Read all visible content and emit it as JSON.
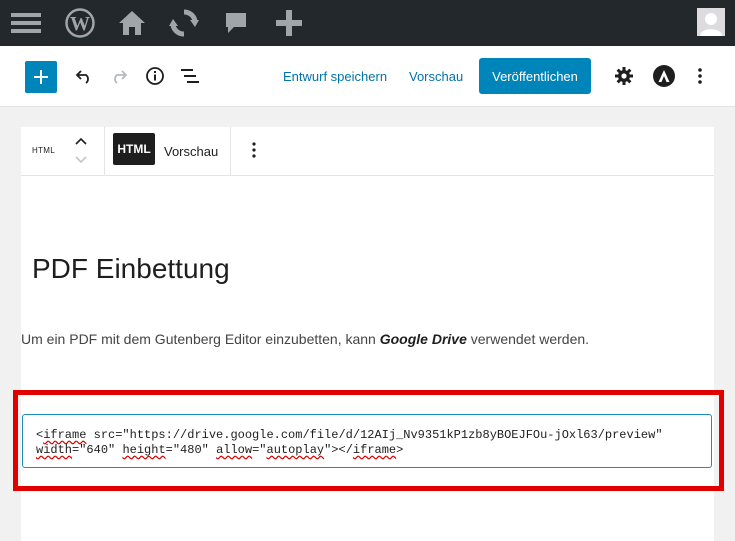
{
  "admin_bar": {
    "icons": [
      "menu-icon",
      "wordpress-logo-icon",
      "home-icon",
      "updates-icon",
      "comments-icon",
      "new-content-icon",
      "avatar"
    ]
  },
  "header": {
    "add_block_label": "+",
    "save_draft": "Entwurf speichern",
    "preview": "Vorschau",
    "publish": "Veröffentlichen"
  },
  "block_toolbar": {
    "block_type": "HTML",
    "tab_html": "HTML",
    "tab_preview": "Vorschau"
  },
  "content": {
    "title": "PDF Einbettung",
    "paragraph_before": "Um ein PDF mit dem Gutenberg Editor einzubetten, kann ",
    "paragraph_bold": "Google Drive",
    "paragraph_after": " verwendet werden.",
    "code_line1_a": "<",
    "code_line1_tag": "iframe",
    "code_line1_b": " src=\"https://drive.google.com/file/d/12AIj_Nv9351kP1zb8yBOEJFOu-jOxl63/preview\"",
    "code_line2_attr1": "width",
    "code_line2_val1": "=\"640\" ",
    "code_line2_attr2": "height",
    "code_line2_val2": "=\"480\" ",
    "code_line2_attr3": "allow",
    "code_line2_eq": "=\"",
    "code_line2_val3": "autoplay",
    "code_line2_close": "\"></",
    "code_line2_tag": "iframe",
    "code_line2_end": ">"
  },
  "colors": {
    "accent": "#0085ba",
    "link": "#0073aa",
    "highlight": "#e00000",
    "adminbar": "#23282d"
  }
}
